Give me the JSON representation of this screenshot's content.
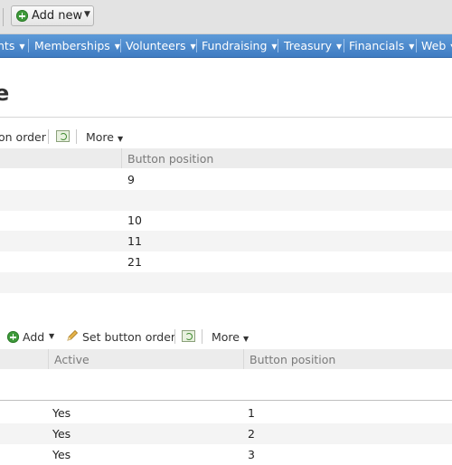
{
  "toolbar": {
    "add_new_label": "Add new"
  },
  "nav": {
    "items": [
      {
        "label": "nts"
      },
      {
        "label": "Memberships"
      },
      {
        "label": "Volunteers"
      },
      {
        "label": "Fundraising"
      },
      {
        "label": "Treasury"
      },
      {
        "label": "Financials"
      },
      {
        "label": "Web"
      }
    ]
  },
  "page": {
    "title": "e"
  },
  "section1": {
    "toolbar": {
      "button_order_label": "on order",
      "more_label": "More"
    },
    "grid": {
      "columns": [
        "Button position"
      ],
      "rows": [
        {
          "button_position": "9"
        },
        {
          "button_position": ""
        },
        {
          "button_position": "10"
        },
        {
          "button_position": "11"
        },
        {
          "button_position": "21"
        },
        {
          "button_position": ""
        }
      ]
    }
  },
  "section2": {
    "toolbar": {
      "add_label": "Add",
      "set_button_order_label": "Set button order",
      "more_label": "More"
    },
    "grid": {
      "columns": [
        "Active",
        "Button position"
      ],
      "rows": [
        {
          "active": "Yes",
          "button_position": "1"
        },
        {
          "active": "Yes",
          "button_position": "2"
        },
        {
          "active": "Yes",
          "button_position": "3"
        }
      ]
    }
  }
}
